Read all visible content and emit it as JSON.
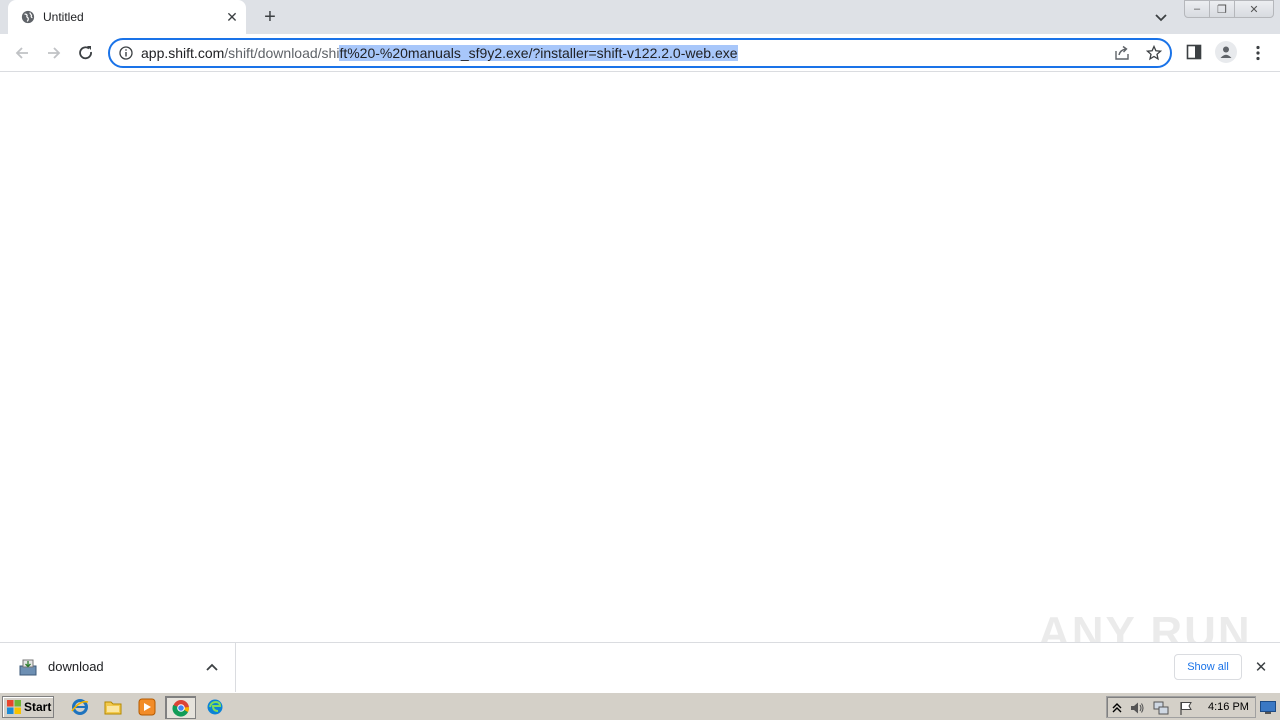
{
  "tab": {
    "title": "Untitled",
    "close_glyph": "✕",
    "favicon": "globe-icon"
  },
  "new_tab_glyph": "+",
  "window_controls": {
    "minimize_glyph": "‒",
    "maximize_glyph": "❐",
    "close_glyph": "✕"
  },
  "omnibox": {
    "url_host": "app.shift.com",
    "url_path_plain": "/shift/download/shi",
    "url_path_selected": "ft%20-%20manuals_sf9y2.exe/?installer=shift-v122.2.0-web.exe",
    "accent": "#1a73e8",
    "selection_color": "#a8c7fa"
  },
  "download_shelf": {
    "item_name": "download",
    "show_all_label": "Show all",
    "close_glyph": "✕"
  },
  "watermark": {
    "text": "ANY RUN"
  },
  "taskbar": {
    "start_label": "Start",
    "clock": "4:16 PM",
    "pinned": [
      "internet-explorer-icon",
      "folder-icon",
      "media-player-icon",
      "chrome-icon",
      "edge-icon"
    ]
  }
}
